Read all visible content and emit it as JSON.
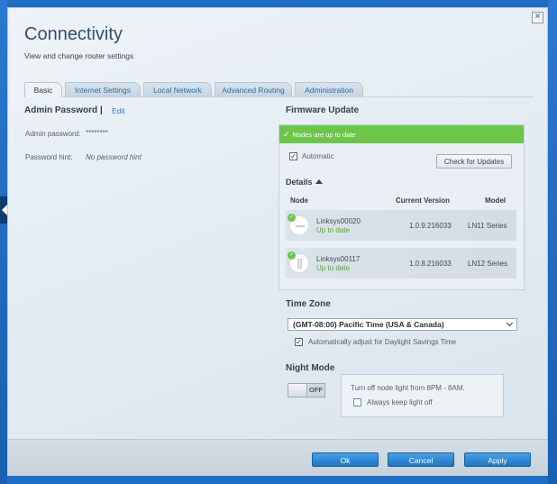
{
  "dialog": {
    "title": "Connectivity",
    "subtitle": "View and change router settings"
  },
  "tabs": [
    {
      "label": "Basic",
      "active": true
    },
    {
      "label": "Internet Settings",
      "active": false
    },
    {
      "label": "Local Network",
      "active": false
    },
    {
      "label": "Advanced Routing",
      "active": false
    },
    {
      "label": "Administration",
      "active": false
    }
  ],
  "admin": {
    "title": "Admin Password",
    "separator": "|",
    "edit_label": "Edit",
    "password_label": "Admin password:",
    "password_value": "********",
    "hint_label": "Password hint:",
    "hint_value": "No password hint"
  },
  "firmware": {
    "title": "Firmware Update",
    "banner": "Nodes are up to date",
    "automatic_label": "Automatic",
    "automatic_checked": true,
    "check_button": "Check for Updates",
    "details_label": "Details",
    "columns": {
      "node": "Node",
      "version": "Current Version",
      "model": "Model"
    },
    "nodes": [
      {
        "name": "Linksys00020",
        "status": "Up to date",
        "version": "1.0.9.216033",
        "model": "LN11 Series"
      },
      {
        "name": "Linksys00117",
        "status": "Up to date",
        "version": "1.0.8.216033",
        "model": "LN12 Series"
      }
    ]
  },
  "timezone": {
    "title": "Time Zone",
    "selected": "(GMT-08:00) Pacific Time (USA & Canada)",
    "dst_label": "Automatically adjust for Daylight Savings Time",
    "dst_checked": true
  },
  "night_mode": {
    "title": "Night Mode",
    "toggle_label": "OFF",
    "description": "Turn off node light from 8PM - 8AM.",
    "always_off_label": "Always keep light off",
    "always_off_checked": false
  },
  "footer": {
    "ok": "Ok",
    "cancel": "Cancel",
    "apply": "Apply"
  },
  "close_glyph": "×",
  "colors": {
    "accent": "#2b7bc0",
    "success": "#6cc64a",
    "primary_button": "#2a82d0"
  }
}
